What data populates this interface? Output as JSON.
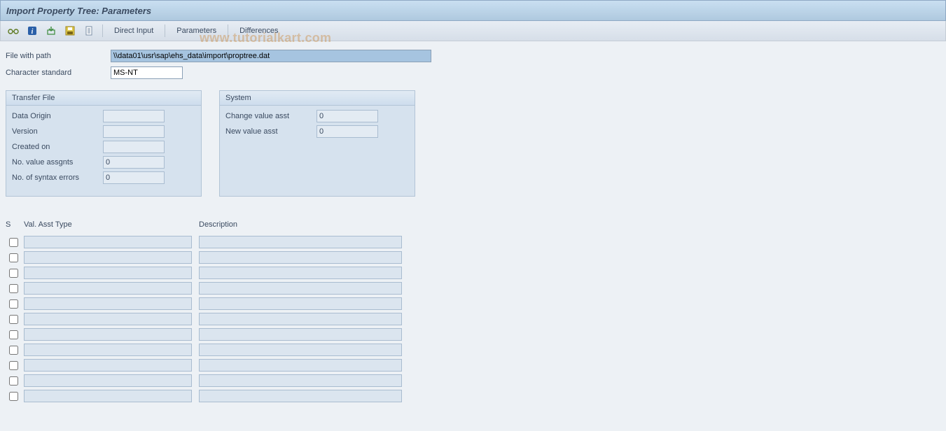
{
  "title": "Import Property Tree: Parameters",
  "watermark": "www.tutorialkart.com",
  "toolbar": {
    "direct_input": "Direct Input",
    "parameters": "Parameters",
    "differences": "Differences"
  },
  "form": {
    "file_with_path_label": "File with path",
    "file_with_path_value": "\\\\data01\\usr\\sap\\ehs_data\\import\\proptree.dat",
    "char_std_label": "Character standard",
    "char_std_value": "MS-NT"
  },
  "transfer_file": {
    "title": "Transfer File",
    "data_origin_label": "Data Origin",
    "data_origin_value": "",
    "version_label": "Version",
    "version_value": "",
    "created_on_label": "Created on",
    "created_on_value": "",
    "no_val_assgnts_label": "No. value assgnts",
    "no_val_assgnts_value": "0",
    "no_syntax_errors_label": "No. of syntax errors",
    "no_syntax_errors_value": "0"
  },
  "system": {
    "title": "System",
    "change_val_asst_label": "Change value asst",
    "change_val_asst_value": "0",
    "new_val_asst_label": "New value asst",
    "new_val_asst_value": "0"
  },
  "table": {
    "col_s": "S",
    "col_vat": "Val. Asst Type",
    "col_desc": "Description",
    "rows": [
      {
        "s": false,
        "vat": "",
        "desc": ""
      },
      {
        "s": false,
        "vat": "",
        "desc": ""
      },
      {
        "s": false,
        "vat": "",
        "desc": ""
      },
      {
        "s": false,
        "vat": "",
        "desc": ""
      },
      {
        "s": false,
        "vat": "",
        "desc": ""
      },
      {
        "s": false,
        "vat": "",
        "desc": ""
      },
      {
        "s": false,
        "vat": "",
        "desc": ""
      },
      {
        "s": false,
        "vat": "",
        "desc": ""
      },
      {
        "s": false,
        "vat": "",
        "desc": ""
      },
      {
        "s": false,
        "vat": "",
        "desc": ""
      },
      {
        "s": false,
        "vat": "",
        "desc": ""
      }
    ]
  }
}
